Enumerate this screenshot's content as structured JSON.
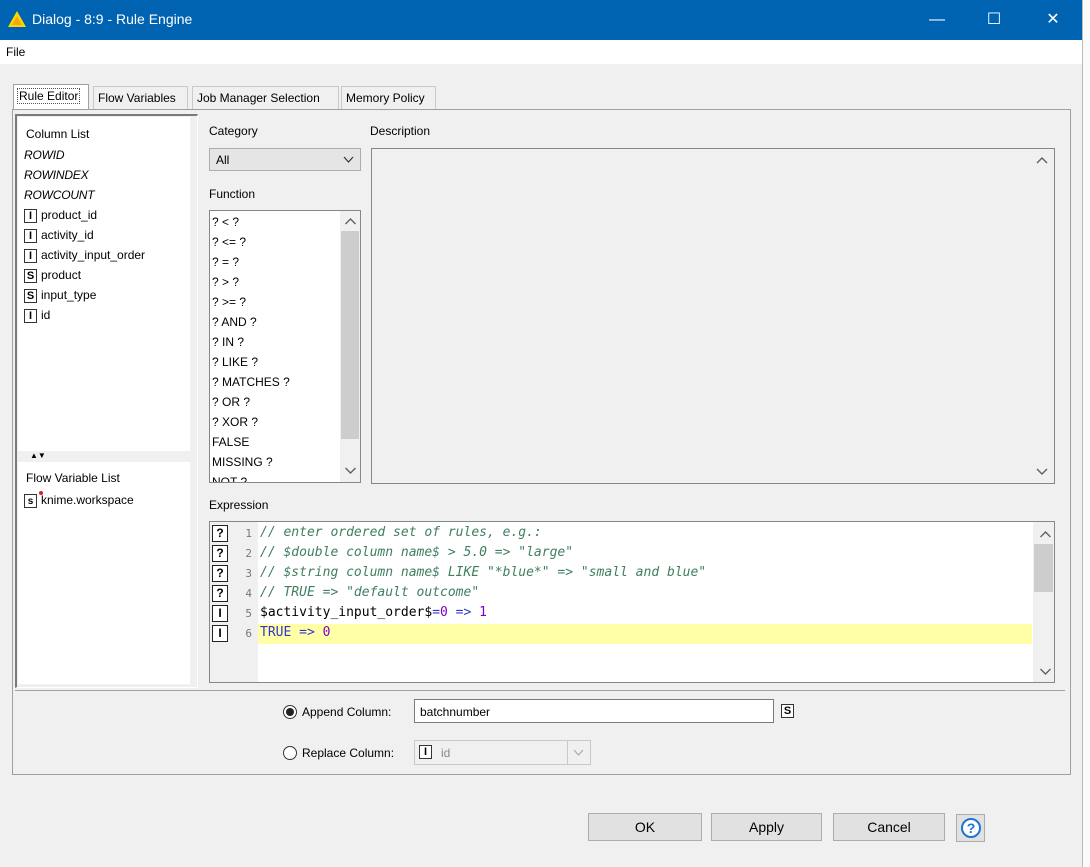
{
  "window": {
    "title": "Dialog - 8:9 - Rule Engine",
    "minimize": "—",
    "maximize": "☐",
    "close": "✕"
  },
  "menu": {
    "file": "File"
  },
  "tabs": [
    "Rule Editor",
    "Flow Variables",
    "Job Manager Selection",
    "Memory Policy"
  ],
  "column_list": {
    "title": "Column List",
    "special": [
      "ROWID",
      "ROWINDEX",
      "ROWCOUNT"
    ],
    "columns": [
      {
        "type": "I",
        "name": "product_id"
      },
      {
        "type": "I",
        "name": "activity_id"
      },
      {
        "type": "I",
        "name": "activity_input_order"
      },
      {
        "type": "S",
        "name": "product"
      },
      {
        "type": "S",
        "name": "input_type"
      },
      {
        "type": "I",
        "name": "id"
      }
    ]
  },
  "flow_variable_list": {
    "title": "Flow Variable List",
    "items": [
      {
        "type": "s",
        "name": "knime.workspace"
      }
    ]
  },
  "category": {
    "label": "Category",
    "value": "All"
  },
  "function": {
    "label": "Function",
    "items": [
      "? < ?",
      "? <= ?",
      "? = ?",
      "? > ?",
      "? >= ?",
      "? AND ?",
      "? IN ?",
      "? LIKE ?",
      "? MATCHES ?",
      "? OR ?",
      "? XOR ?",
      "FALSE",
      "MISSING ?",
      "NOT ?"
    ]
  },
  "description": {
    "label": "Description"
  },
  "expression": {
    "label": "Expression",
    "lines": [
      {
        "n": "1",
        "badge": "?",
        "text": "// enter ordered set of rules, e.g.:"
      },
      {
        "n": "2",
        "badge": "?",
        "text": "// $double column name$ > 5.0 => \"large\""
      },
      {
        "n": "3",
        "badge": "?",
        "text": "// $string column name$ LIKE \"*blue*\" => \"small and blue\""
      },
      {
        "n": "4",
        "badge": "?",
        "text": "// TRUE => \"default outcome\""
      },
      {
        "n": "5",
        "badge": "I",
        "col": "$activity_input_order$",
        "op1": "=",
        "v1": "0",
        "op2": " => ",
        "v2": "1"
      },
      {
        "n": "6",
        "badge": "I",
        "kw": "TRUE",
        "op2": " => ",
        "v2": "0"
      }
    ]
  },
  "output": {
    "append_label": "Append Column:",
    "append_value": "batchnumber",
    "append_type": "S",
    "replace_label": "Replace Column:",
    "replace_type": "I",
    "replace_value": "id"
  },
  "buttons": {
    "ok": "OK",
    "apply": "Apply",
    "cancel": "Cancel",
    "help": "?"
  }
}
